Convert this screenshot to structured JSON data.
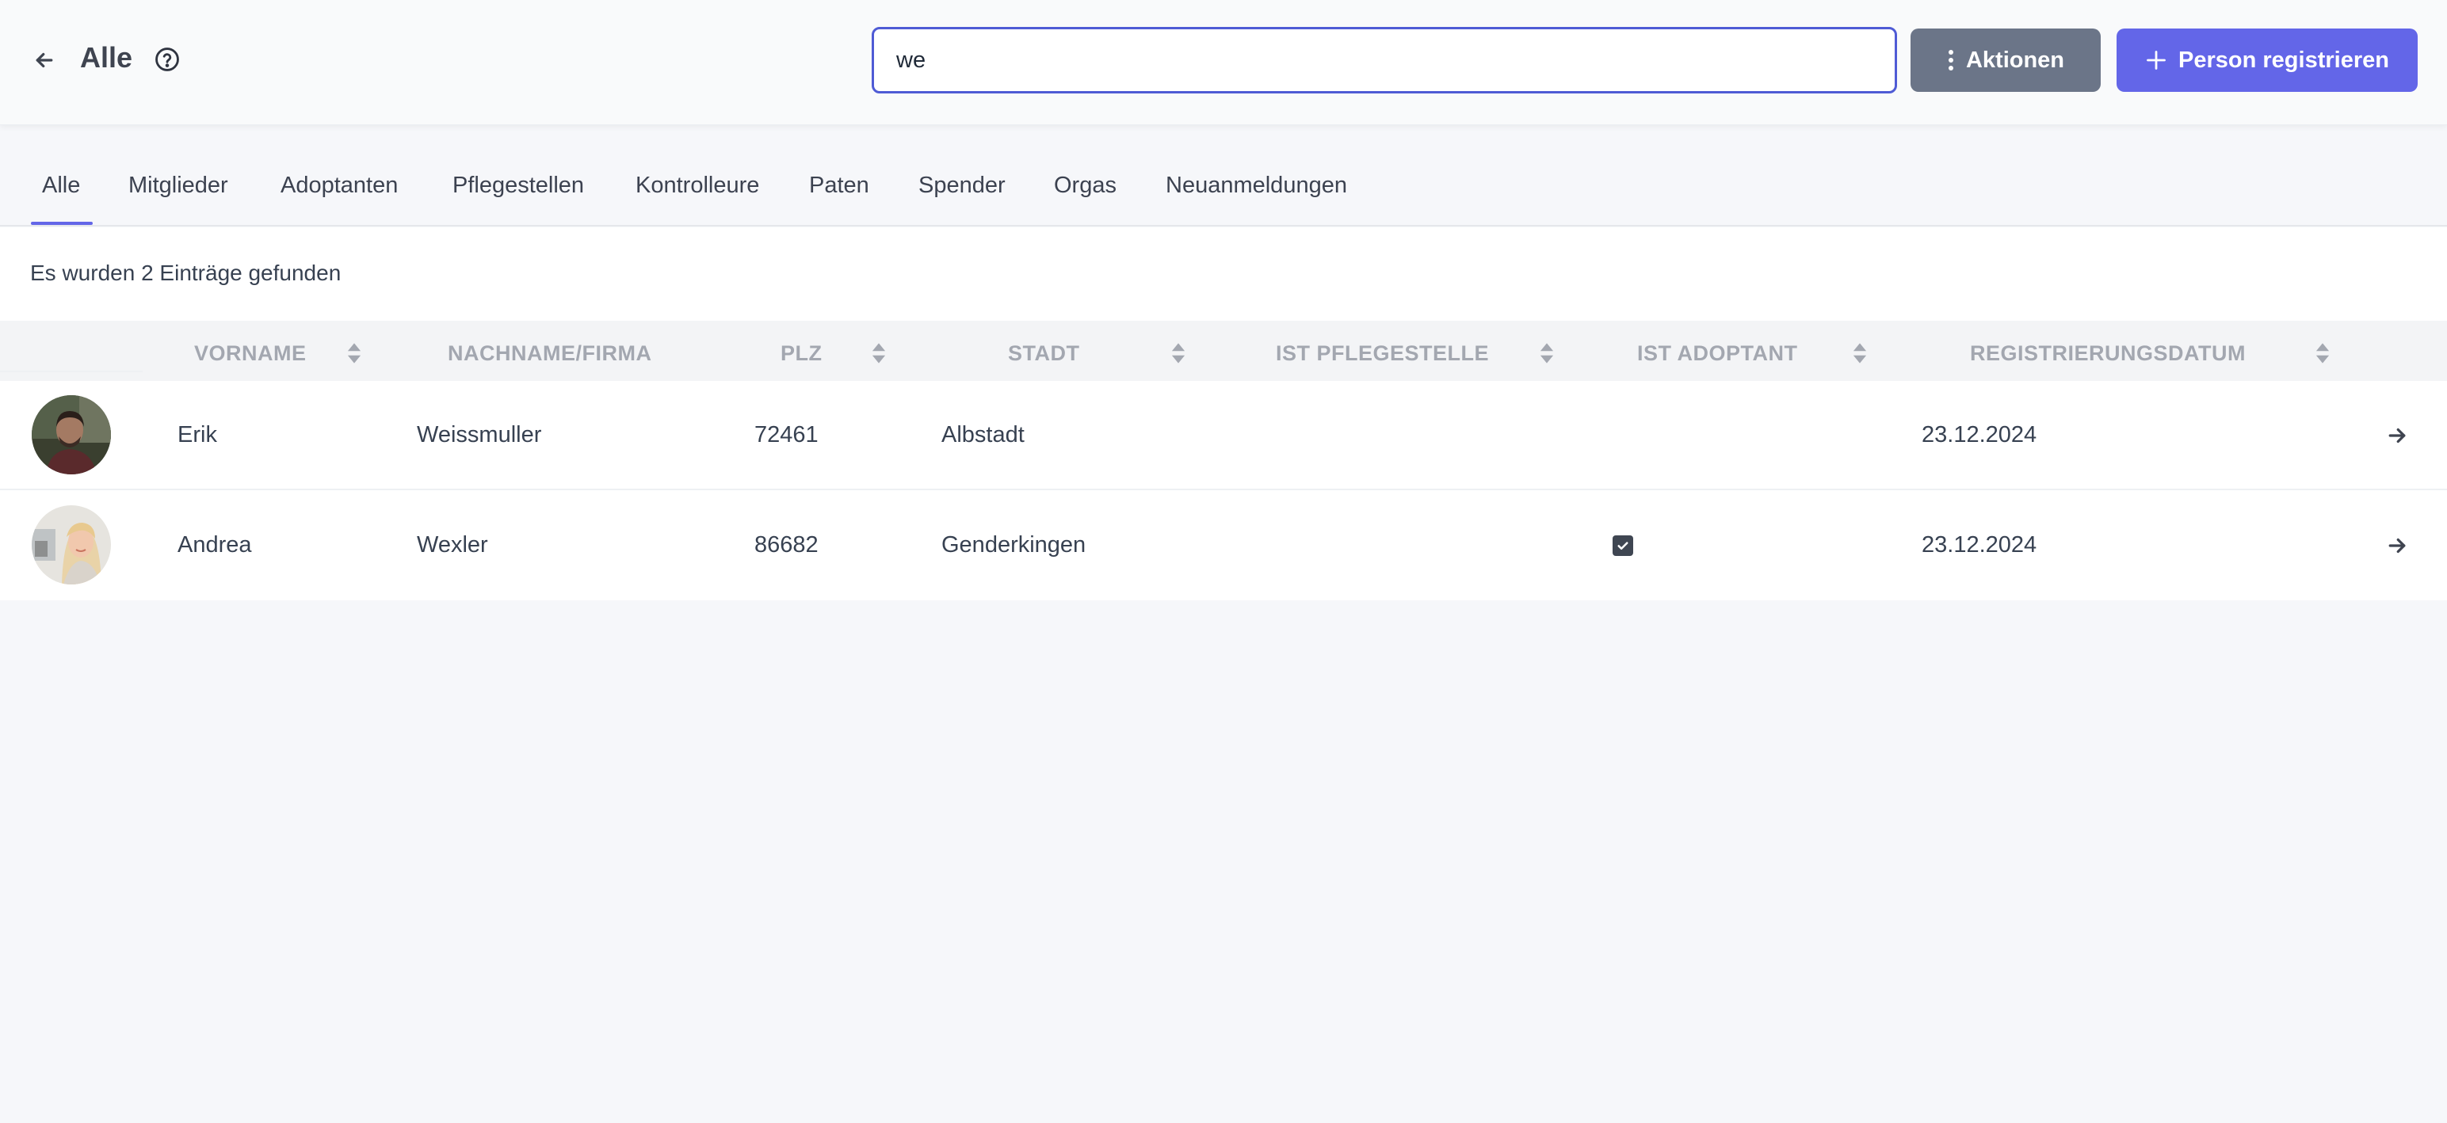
{
  "header": {
    "title": "Alle",
    "back_icon": "arrow-left-icon",
    "help_icon": "question-circle-icon",
    "search": {
      "value": "we",
      "placeholder": ""
    },
    "actions_label": "Aktionen",
    "register_label": "Person registrieren",
    "accent_color": "#6366e8",
    "actions_color": "#6b7588"
  },
  "tabs": {
    "active": "Alle",
    "items": [
      {
        "label": "Alle"
      },
      {
        "label": "Mitglieder"
      },
      {
        "label": "Adoptanten"
      },
      {
        "label": "Pflegestellen"
      },
      {
        "label": "Kontrolleure"
      },
      {
        "label": "Paten"
      },
      {
        "label": "Spender"
      },
      {
        "label": "Orgas"
      },
      {
        "label": "Neuanmeldungen"
      }
    ]
  },
  "table": {
    "result_text": "Es wurden 2 Einträge gefunden",
    "columns": [
      {
        "label": "VORNAME",
        "sortable": true
      },
      {
        "label": "NACHNAME/FIRMA",
        "sortable": false
      },
      {
        "label": "PLZ",
        "sortable": true
      },
      {
        "label": "STADT",
        "sortable": true
      },
      {
        "label": "IST PFLEGESTELLE",
        "sortable": true
      },
      {
        "label": "IST ADOPTANT",
        "sortable": true
      },
      {
        "label": "REGISTRIERUNGSDATUM",
        "sortable": true
      }
    ],
    "rows": [
      {
        "first_name": "Erik",
        "last_name": "Weissmuller",
        "zip": "72461",
        "city": "Albstadt",
        "is_foster": false,
        "is_adopter": false,
        "registered": "23.12.2024"
      },
      {
        "first_name": "Andrea",
        "last_name": "Wexler",
        "zip": "86682",
        "city": "Genderkingen",
        "is_foster": false,
        "is_adopter": true,
        "registered": "23.12.2024"
      }
    ]
  }
}
